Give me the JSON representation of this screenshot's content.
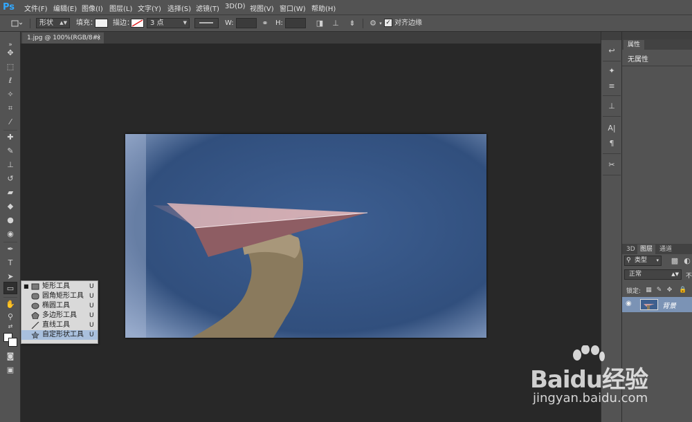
{
  "app": {
    "logo": "Ps"
  },
  "menu": [
    "文件(F)",
    "编辑(E)",
    "图像(I)",
    "图层(L)",
    "文字(Y)",
    "选择(S)",
    "滤镜(T)",
    "3D(D)",
    "视图(V)",
    "窗口(W)",
    "帮助(H)"
  ],
  "options": {
    "mode": "形状",
    "fill_label": "填充：",
    "stroke_label": "描边：",
    "stroke_size": "3 点",
    "w_label": "W:",
    "h_label": "H:",
    "align_edges": "对齐边缘",
    "fill_color": "#f2f2f2",
    "stroke_color": "#ffffff"
  },
  "document": {
    "tab_title": "1.jpg @ 100%(RGB/8#)",
    "close": "×"
  },
  "flyout": {
    "items": [
      {
        "label": "矩形工具",
        "key": "U",
        "selected": false,
        "current": true,
        "icon": "rectangle-icon"
      },
      {
        "label": "圆角矩形工具",
        "key": "U",
        "selected": false,
        "current": false,
        "icon": "rounded-rectangle-icon"
      },
      {
        "label": "椭圆工具",
        "key": "U",
        "selected": false,
        "current": false,
        "icon": "ellipse-icon"
      },
      {
        "label": "多边形工具",
        "key": "U",
        "selected": false,
        "current": false,
        "icon": "polygon-icon"
      },
      {
        "label": "直线工具",
        "key": "U",
        "selected": false,
        "current": false,
        "icon": "line-icon"
      },
      {
        "label": "自定形状工具",
        "key": "U",
        "selected": true,
        "current": false,
        "icon": "custom-shape-icon"
      }
    ]
  },
  "panels": {
    "properties": {
      "tab": "属性",
      "body": "无属性"
    },
    "layers": {
      "tabs": [
        "3D",
        "图层",
        "通道"
      ],
      "active_tab": "图层",
      "filter": "类型",
      "blend_mode": "正常",
      "opacity_label": "不",
      "lock_label": "锁定:",
      "layer_name": "背景"
    }
  },
  "watermark": {
    "logo": "Baidu经验",
    "url": "jingyan.baidu.com"
  }
}
